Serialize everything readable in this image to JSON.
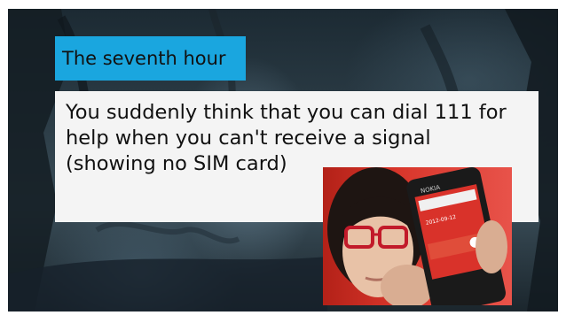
{
  "slide": {
    "title": "The seventh hour",
    "body_lines": [
      "You suddenly think that you can dial 111 for",
      "help when you can't receive a signal",
      "(showing no SIM card)"
    ]
  },
  "photo": {
    "phone_brand": "NOKIA",
    "phone_date": "2012-09-12"
  },
  "colors": {
    "title_bg": "#1aa6df",
    "text_box_bg": "#f4f4f4",
    "background": "#2d3e48"
  }
}
